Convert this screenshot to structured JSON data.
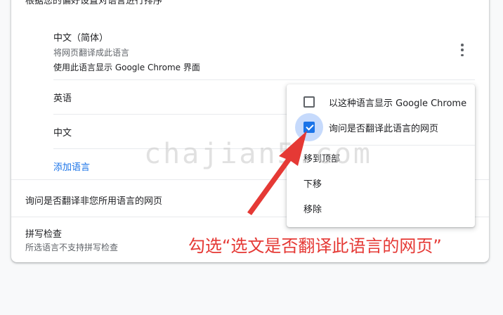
{
  "settings": {
    "sort_hint": "根据您的偏好设置对语言进行排序",
    "languages": [
      {
        "name": "中文（简体）",
        "sub1": "将网页翻译成此语言",
        "sub2": "使用此语言显示 Google Chrome 界面"
      },
      {
        "name": "英语"
      },
      {
        "name": "中文"
      }
    ],
    "add_language": "添加语言",
    "offer_translate": "询问是否翻译非您所用语言的网页",
    "spellcheck_title": "拼写检查",
    "spellcheck_sub": "所选语言不支持拼写检查"
  },
  "menu": {
    "display_in_language": "以这种语言显示 Google Chrome",
    "display_checked": false,
    "offer_translate_this": "询问是否翻译此语言的网页",
    "offer_checked": true,
    "move_top": "移到顶部",
    "move_down": "下移",
    "remove": "移除"
  },
  "overlay": {
    "watermark": "chajian5.com",
    "annotation": "勾选“选文是否翻译此语言的网页”",
    "annotation_color": "#e53935"
  },
  "colors": {
    "accent": "#1a73e8",
    "ripple": "#c6dafc"
  }
}
